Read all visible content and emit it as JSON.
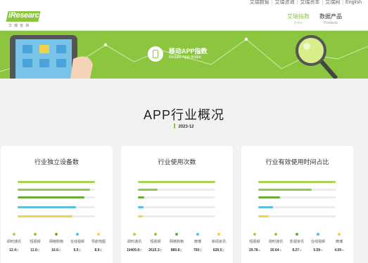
{
  "top_links": [
    "艾瑞数智",
    "艾瑞咨询",
    "艾瑞资本",
    "艾瑞网",
    "English"
  ],
  "logo": {
    "text": "iResearch",
    "sub": "艾瑞咨询"
  },
  "nav": [
    {
      "label": "艾瑞指数",
      "en": "iIndex",
      "active": true
    },
    {
      "label": "数据产品",
      "en": "Products",
      "active": false
    }
  ],
  "banner": {
    "title": "移动APP指数",
    "subtitle": "Mobile App Index"
  },
  "page_title": "APP行业概况",
  "date": "2023-12",
  "colors": {
    "accent": "#8cc63f",
    "series": [
      "#a9d45a",
      "#93c94b",
      "#6aac36",
      "#5bc0de",
      "#f0d44a"
    ]
  },
  "cards": [
    {
      "title": "行业独立设备数",
      "fills": [
        1.0,
        0.94,
        0.86,
        0.75,
        0.71
      ],
      "legend": [
        {
          "name": "即时通讯",
          "value": "12.4",
          "unit": "亿"
        },
        {
          "name": "短视频",
          "value": "11.6",
          "unit": "亿"
        },
        {
          "name": "网络购物",
          "value": "10.6",
          "unit": "亿"
        },
        {
          "name": "在线视频",
          "value": "9.5",
          "unit": "亿"
        },
        {
          "name": "导航地图",
          "value": "8.9",
          "unit": "亿"
        }
      ]
    },
    {
      "title": "行业使用次数",
      "fills": [
        1.0,
        0.25,
        0.085,
        0.072,
        0.06
      ],
      "legend": [
        {
          "name": "即时通讯",
          "value": "10409.9",
          "unit": "亿"
        },
        {
          "name": "短视频",
          "value": "2615.3",
          "unit": "亿"
        },
        {
          "name": "网络购物",
          "value": "889.8",
          "unit": "亿"
        },
        {
          "name": "微博",
          "value": "750",
          "unit": "亿"
        },
        {
          "name": "新闻资讯",
          "value": "628.5",
          "unit": "亿"
        }
      ]
    },
    {
      "title": "行业有效使用时间占比",
      "fills": [
        1.0,
        0.69,
        0.28,
        0.19,
        0.14
      ],
      "legend": [
        {
          "name": "短视频",
          "value": "29.78",
          "unit": "%"
        },
        {
          "name": "即时通讯",
          "value": "20.64",
          "unit": "%"
        },
        {
          "name": "影视资讯",
          "value": "8.27",
          "unit": "%"
        },
        {
          "name": "在线视频",
          "value": "5.59",
          "unit": "%"
        },
        {
          "name": "微博",
          "value": "4.09",
          "unit": "%"
        }
      ]
    }
  ]
}
